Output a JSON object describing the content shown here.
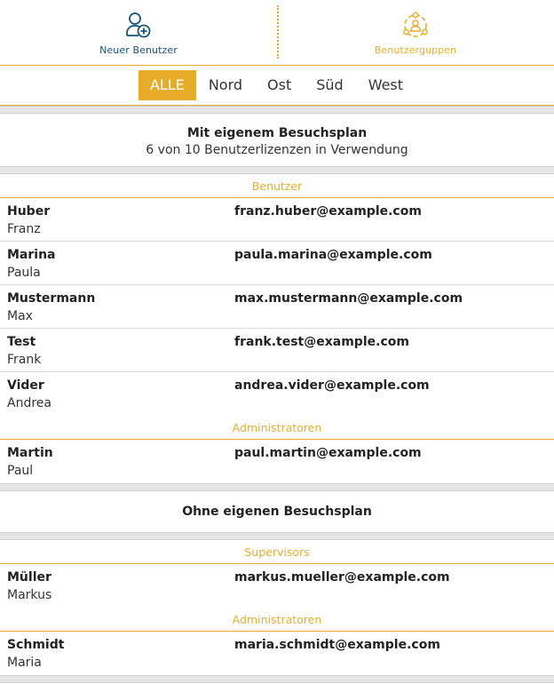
{
  "topbar": {
    "new_user_label": "Neuer Benutzer",
    "new_user_icon": "add-user-icon",
    "groups_label": "Benutzerguppen",
    "groups_icon": "user-groups-icon"
  },
  "filters": [
    "ALLE",
    "Nord",
    "Ost",
    "Süd",
    "West"
  ],
  "active_filter": "ALLE",
  "colors": {
    "accent": "#e7ad2a",
    "primary": "#16547a"
  },
  "with_plan": {
    "title": "Mit eigenem Besuchsplan",
    "subtitle": "6 von 10 Benutzerlizenzen in Verwendung",
    "users_label": "Benutzer",
    "users": [
      {
        "last": "Huber",
        "first": "Franz",
        "email": "franz.huber@example.com"
      },
      {
        "last": "Marina",
        "first": "Paula",
        "email": "paula.marina@example.com"
      },
      {
        "last": "Mustermann",
        "first": "Max",
        "email": "max.mustermann@example.com"
      },
      {
        "last": "Test",
        "first": "Frank",
        "email": "frank.test@example.com"
      },
      {
        "last": "Vider",
        "first": "Andrea",
        "email": "andrea.vider@example.com"
      }
    ],
    "admins_label": "Administratoren",
    "admins": [
      {
        "last": "Martin",
        "first": "Paul",
        "email": "paul.martin@example.com"
      }
    ]
  },
  "without_plan": {
    "title": "Ohne eigenen Besuchsplan",
    "supervisors_label": "Supervisors",
    "supervisors": [
      {
        "last": "Müller",
        "first": "Markus",
        "email": "markus.mueller@example.com"
      }
    ],
    "admins_label": "Administratoren",
    "admins": [
      {
        "last": "Schmidt",
        "first": "Maria",
        "email": "maria.schmidt@example.com"
      }
    ]
  }
}
